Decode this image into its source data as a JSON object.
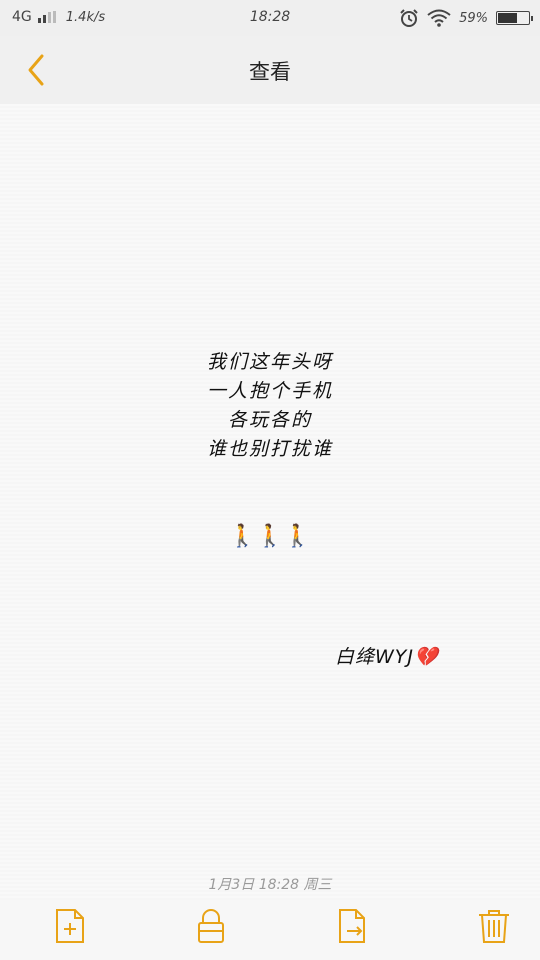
{
  "status": {
    "network": "4G",
    "speed": "1.4k/s",
    "time": "18:28",
    "battery_text": "59%",
    "battery_level": 0.59
  },
  "nav": {
    "title": "查看"
  },
  "note": {
    "lines": [
      "我们这年头呀",
      "一人抱个手机",
      "各玩各的",
      "谁也别打扰谁"
    ],
    "walkers": "🚶🚶🚶",
    "signature": "白绛WYJ💔",
    "timestamp": "1月3日 18:28 周三"
  },
  "colors": {
    "accent": "#e8a317",
    "statusbar_bg": "#efefef",
    "navbar_bg": "#f0f0f0",
    "page_bg": "#f9f9f9"
  },
  "toolbar": {
    "icons": [
      "add-note-icon",
      "lock-icon",
      "share-icon",
      "trash-icon"
    ]
  }
}
